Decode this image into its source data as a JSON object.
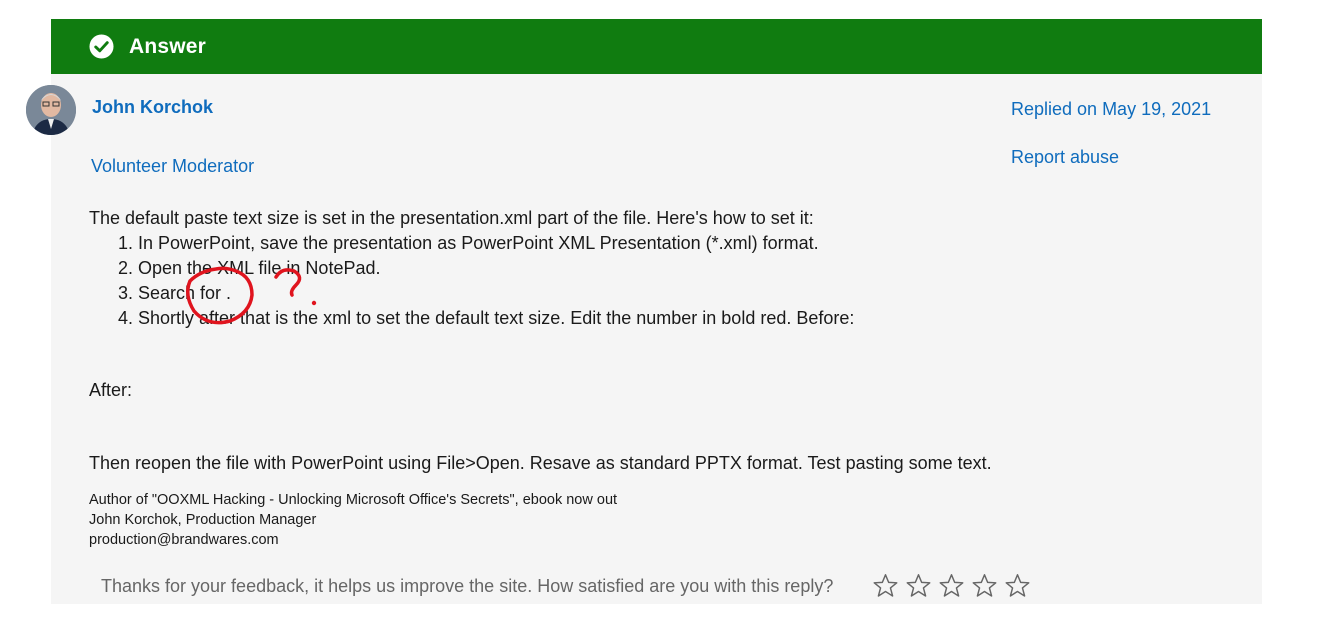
{
  "answer": {
    "title": "Answer"
  },
  "author": {
    "name": "John Korchok",
    "role": "Volunteer Moderator"
  },
  "meta": {
    "replied": "Replied on May 19, 2021",
    "report": "Report abuse"
  },
  "content": {
    "intro": "The default paste text size is set in the presentation.xml part of the file. Here's how to set it:",
    "steps": [
      "1. In PowerPoint, save the presentation as PowerPoint XML Presentation (*.xml) format.",
      "2. Open the XML file in NotePad.",
      "3. Search for .",
      "4. Shortly after that is the xml to set the default text size. Edit the number in bold red. Before:"
    ],
    "after": "After:",
    "closing": "Then reopen the file with PowerPoint using File>Open. Resave as standard PPTX format. Test pasting some text."
  },
  "signature": {
    "line1": "Author of \"OOXML Hacking - Unlocking Microsoft Office's Secrets\", ebook now out",
    "line2": "John Korchok, Production Manager",
    "line3": "production@brandwares.com"
  },
  "feedback": {
    "prompt": "Thanks for your feedback, it helps us improve the site. How satisfied are you with this reply?",
    "stars_total": 5,
    "stars_selected": 0
  },
  "colors": {
    "answer_green": "#107c10",
    "link_blue": "#0f6cbd",
    "annotation_red": "#e0141e"
  }
}
